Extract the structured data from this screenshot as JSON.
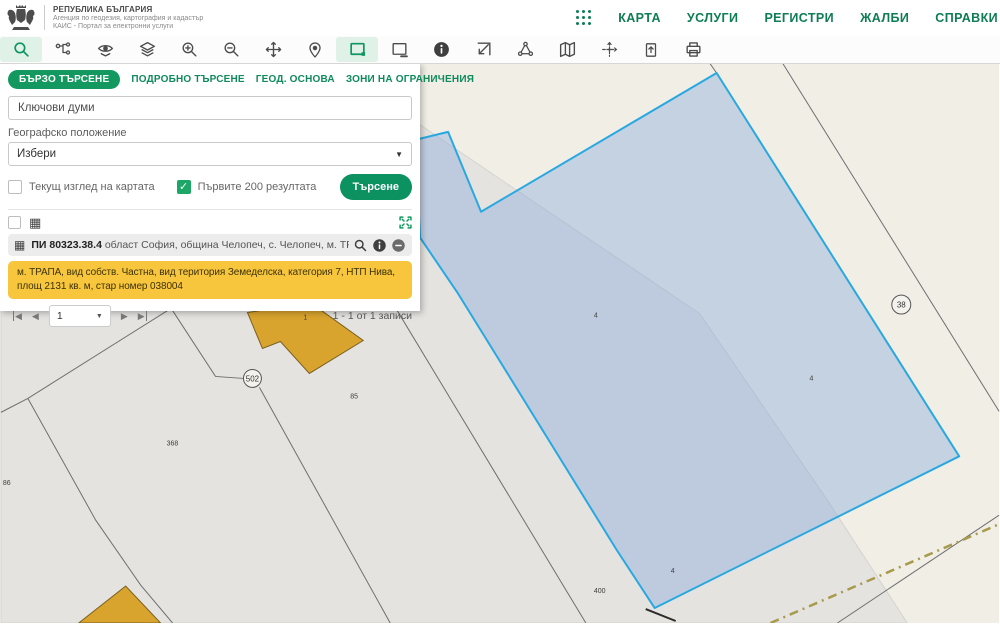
{
  "header": {
    "brand": {
      "title": "РЕПУБЛИКА БЪЛГАРИЯ",
      "subtitle1": "Агенция по геодезия, картография и кадастър",
      "subtitle2": "КАИС - Портал за електронни услуги"
    },
    "nav": {
      "apps_icon": "apps-grid-icon",
      "items": [
        "КАРТА",
        "УСЛУГИ",
        "РЕГИСТРИ",
        "ЖАЛБИ",
        "СПРАВКИ"
      ]
    }
  },
  "toolbar": {
    "tools": [
      "search",
      "route-tree",
      "layers-visibility",
      "layers",
      "zoom-in",
      "zoom-out",
      "pan",
      "locate-pin",
      "select-rectangle",
      "deselect-rectangle",
      "info",
      "full-extent",
      "measure-area",
      "map-sheets",
      "coordinates",
      "export-page",
      "print"
    ],
    "active_tools": [
      "search",
      "select-rectangle"
    ]
  },
  "search_panel": {
    "tabs": [
      {
        "label": "БЪРЗО ТЪРСЕНЕ",
        "active": true
      },
      {
        "label": "ПОДРОБНО ТЪРСЕНЕ",
        "active": false
      },
      {
        "label": "ГЕОД. ОСНОВА",
        "active": false
      },
      {
        "label": "ЗОНИ НА ОГРАНИЧЕНИЯ",
        "active": false
      }
    ],
    "keywords_placeholder": "Ключови думи",
    "geo_label": "Географско положение",
    "geo_value": "Избери",
    "checkbox_current_view": {
      "label": "Текущ изглед на картата",
      "checked": false
    },
    "checkbox_first200": {
      "label": "Първите 200 резултата",
      "checked": true,
      "checkmark": "✓"
    },
    "search_button": "Търсене",
    "result": {
      "id_bold": "ПИ 80323.38.4",
      "location": " област София, община Челопеч, с. Челопеч, м. ТРАПА",
      "details": "м. ТРАПА, вид собств. Частна, вид територия Земеделска, категория 7, НТП Нива, площ 2131 кв. м, стар номер 038004"
    },
    "pagination": {
      "first": "◀",
      "prev": "◀",
      "next": "▶",
      "last": "▶",
      "page": "1",
      "select_arrow": "▼",
      "records": "1 - 1 от 1 записи"
    },
    "select_arrow": "▼",
    "grid_glyph": "▦"
  },
  "map": {
    "labels": {
      "circle502": "502",
      "circle38": "38",
      "bld1": "1",
      "p85": "85",
      "p368": "368",
      "p86": "86",
      "p4a": "4",
      "p4b": "4",
      "p4c": "4",
      "p400": "400"
    },
    "selected_parcel": "ПИ 80323.38.4"
  },
  "colors": {
    "accent_green": "#0f9563",
    "nav_green": "#0e7d54",
    "selection_cyan": "#29a8e0",
    "parcel_fill_blue": "#7fa6dc",
    "building_fill": "#d9a42e",
    "info_box_bg": "#f8c63d",
    "map_beige": "#f1eee6",
    "map_gray": "#e5e3e0"
  }
}
